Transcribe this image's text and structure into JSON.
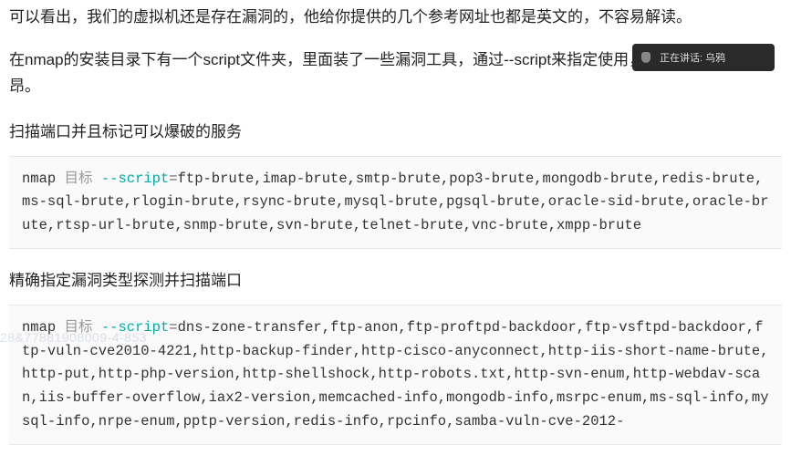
{
  "para1": "可以看出，我们的虚拟机还是存在漏洞的，他给你提供的几个参考网址也都是英文的，不容易解读。",
  "para2": "在nmap的安装目录下有一个script文件夹，里面装了一些漏洞工具，通过--script来指定使用，不需要大家掌握昂。",
  "heading1": "扫描端口并且标记可以爆破的服务",
  "heading2": "精确指定漏洞类型探测并扫描端口",
  "notice_text": "正在讲话: 乌鸦",
  "code1": {
    "cmd": "nmap",
    "target": "目标",
    "flag": "--script",
    "eq": "=",
    "rest": "ftp-brute,imap-brute,smtp-brute,pop3-brute,mongodb-brute,redis-brute,ms-sql-brute,rlogin-brute,rsync-brute,mysql-brute,pgsql-brute,oracle-sid-brute,oracle-brute,rtsp-url-brute,snmp-brute,svn-brute,telnet-brute,vnc-brute,xmpp-brute"
  },
  "code2": {
    "cmd": "nmap",
    "target": "目标",
    "flag": "--script",
    "eq": "=",
    "rest": "dns-zone-transfer,ftp-anon,ftp-proftpd-backdoor,ftp-vsftpd-backdoor,ftp-vuln-cve2010-4221,http-backup-finder,http-cisco-anyconnect,http-iis-short-name-brute,http-put,http-php-version,http-shellshock,http-robots.txt,http-svn-enum,http-webdav-scan,iis-buffer-overflow,iax2-version,memcached-info,mongodb-info,msrpc-enum,ms-sql-info,mysql-info,nrpe-enum,pptp-version,redis-info,rpcinfo,samba-vuln-cve-2012-"
  },
  "watermark": "28&77881908009-4-853"
}
